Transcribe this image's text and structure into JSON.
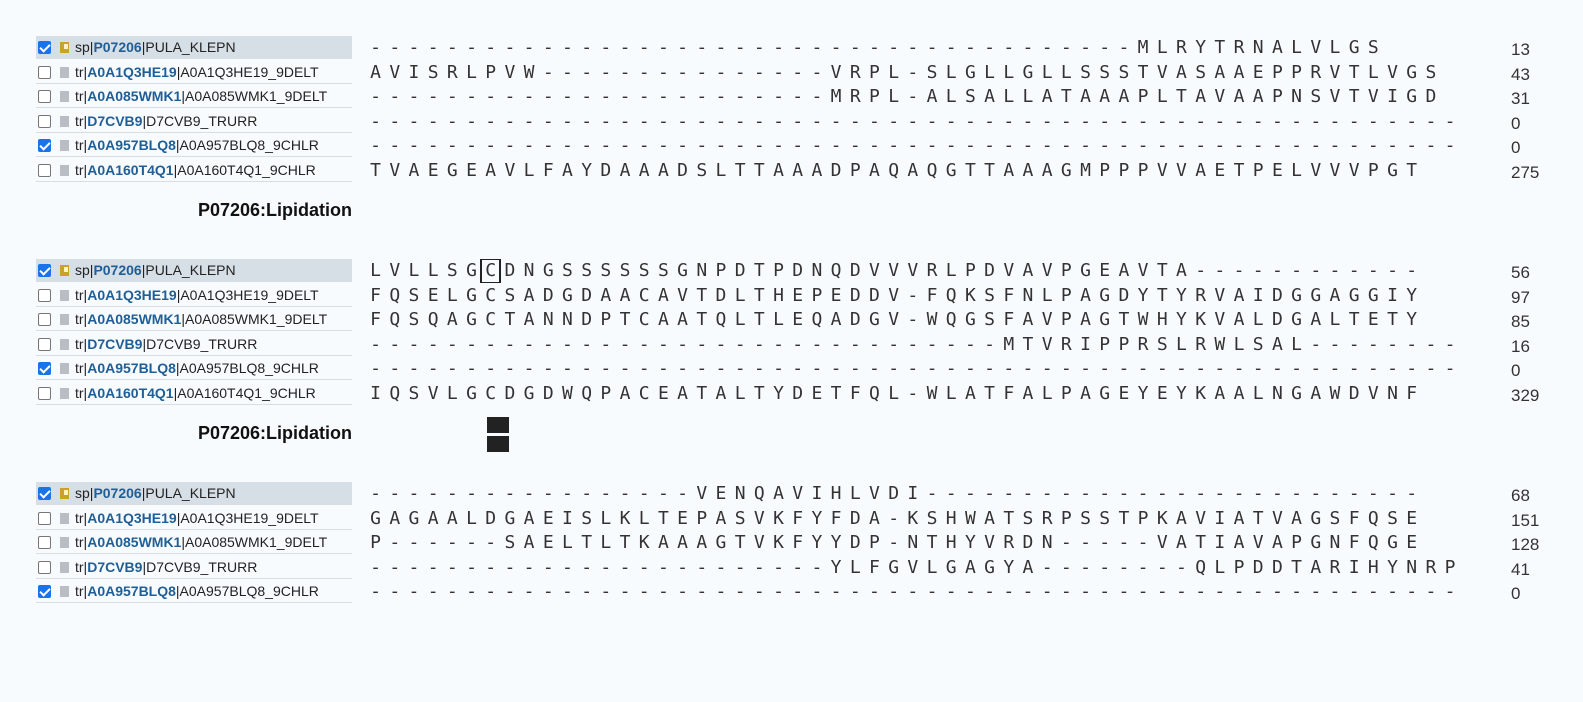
{
  "sequences": [
    {
      "db": "sp",
      "accession": "P07206",
      "name": "PULA_KLEPN",
      "checked": true,
      "reviewed": true
    },
    {
      "db": "tr",
      "accession": "A0A1Q3HE19",
      "name": "A0A1Q3HE19_9DELT",
      "checked": false,
      "reviewed": false
    },
    {
      "db": "tr",
      "accession": "A0A085WMK1",
      "name": "A0A085WMK1_9DELT",
      "checked": false,
      "reviewed": false
    },
    {
      "db": "tr",
      "accession": "D7CVB9",
      "name": "D7CVB9_TRURR",
      "checked": false,
      "reviewed": false
    },
    {
      "db": "tr",
      "accession": "A0A957BLQ8",
      "name": "A0A957BLQ8_9CHLR",
      "checked": true,
      "reviewed": false
    },
    {
      "db": "tr",
      "accession": "A0A160T4Q1",
      "name": "A0A160T4Q1_9CHLR",
      "checked": false,
      "reviewed": false
    }
  ],
  "feature_label": "P07206:Lipidation",
  "blocks": [
    {
      "rows": [
        {
          "seq": "----------------------------------------MLRYTRNALVLGS",
          "end": "13"
        },
        {
          "seq": "AVISRLPVW---------------VRPL-SLGLLGLLSSSTVASAAEPPRVTLVGS",
          "end": "43"
        },
        {
          "seq": "------------------------MRPL-ALSALLATAAAPLTAVAAPNSVTVIGD",
          "end": "31"
        },
        {
          "seq": "---------------------------------------------------------",
          "end": "0"
        },
        {
          "seq": "---------------------------------------------------------",
          "end": "0"
        },
        {
          "seq": "TVAEGEAVLFAYDAAADSLTTAAADPAQAQGTTAAAGMPPPVVAETPELVVVPGT",
          "end": "275"
        }
      ],
      "show_feature_mark": false
    },
    {
      "rows": [
        {
          "seq": "LVLLSGCDNGSSSSSSGNPDTPDNQDVVVRLPDVAVPGEAVTA------------",
          "end": "56",
          "boxed": 6
        },
        {
          "seq": "FQSELGCSADGDAACAVTDLTHEPEDDV-FQKSFNLPAGDYTYRVAIDGGAGGIY",
          "end": "97"
        },
        {
          "seq": "FQSQAGCTANNDPTCAATQLTLEQADGV-WQGSFAVPAGTWHYKVALDGALTETY",
          "end": "85"
        },
        {
          "seq": "---------------------------------MTVRIPPRSLRWLSAL--------",
          "end": "16"
        },
        {
          "seq": "---------------------------------------------------------",
          "end": "0"
        },
        {
          "seq": "IQSVLGCDGDWQPACEATALTYDETFQL-WLATFALPAGEYEYKAALNGAWDVNF",
          "end": "329"
        }
      ],
      "show_feature_mark": true
    },
    {
      "rows": [
        {
          "seq": "-----------------VENQAVIHLVDI--------------------------",
          "end": "68"
        },
        {
          "seq": "GAGAALDGAEISLKLTEPASVKFYFDA-KSHWATSRPSSTPKAVIATVAGSFQSE",
          "end": "151"
        },
        {
          "seq": "P------SAELTLTKAAAGTVKFYYDP-NTHYVRDN-----VATIAVAPGNFQGE",
          "end": "128"
        },
        {
          "seq": "------------------------YLFGVLGAGYA--------QLPDDTARIHYNRP",
          "end": "41"
        },
        {
          "seq": "---------------------------------------------------------",
          "end": "0"
        }
      ],
      "show_feature_mark": false
    }
  ]
}
